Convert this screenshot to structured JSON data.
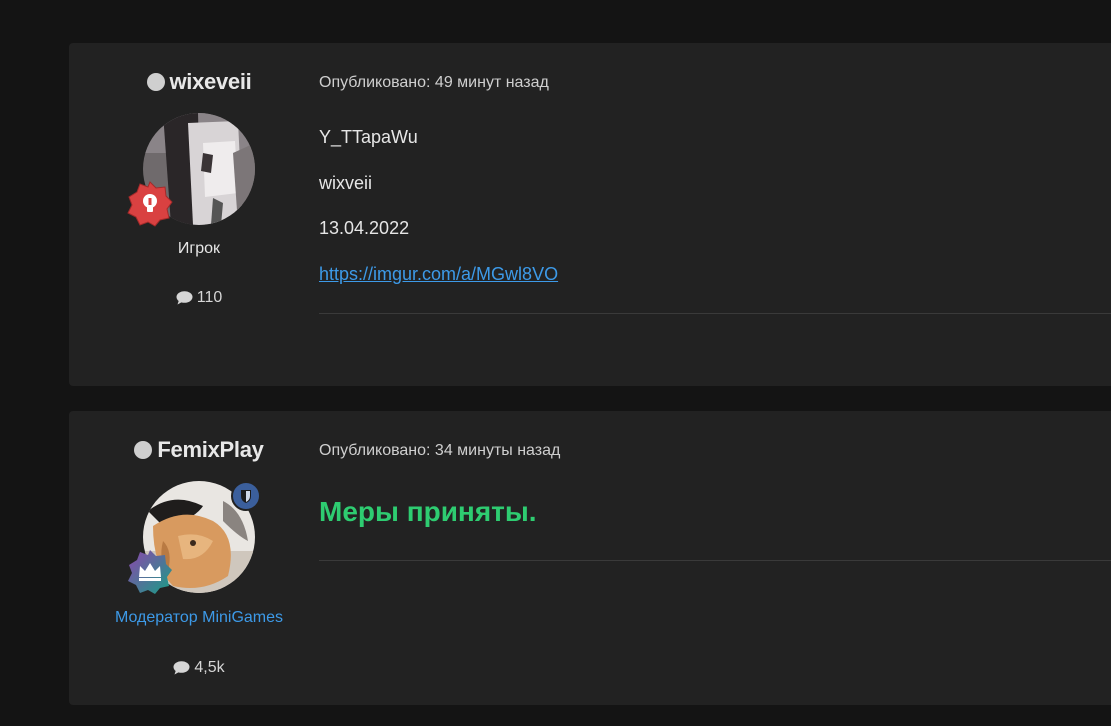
{
  "posts": [
    {
      "author": {
        "name": "wixeveii",
        "role": "Игрок",
        "posts_count": "110",
        "role_color": "#e6e6e6",
        "badge_icon": "lightbulb-icon",
        "badge_color": "#d94141"
      },
      "meta": "Опубликовано: 49 минут назад",
      "lines": [
        "Y_TTapaWu",
        "wixveii",
        "13.04.2022"
      ],
      "link": "https://imgur.com/a/MGwl8VO"
    },
    {
      "author": {
        "name": "FemixPlay",
        "role": "Модератор MiniGames",
        "posts_count": "4,5k",
        "role_color": "#3d9ae8",
        "badge_icon": "crown-icon",
        "mod_icon": "shield-icon"
      },
      "meta": "Опубликовано: 34 минуты назад",
      "message": "Меры приняты.",
      "message_color": "#2ecc71"
    }
  ]
}
